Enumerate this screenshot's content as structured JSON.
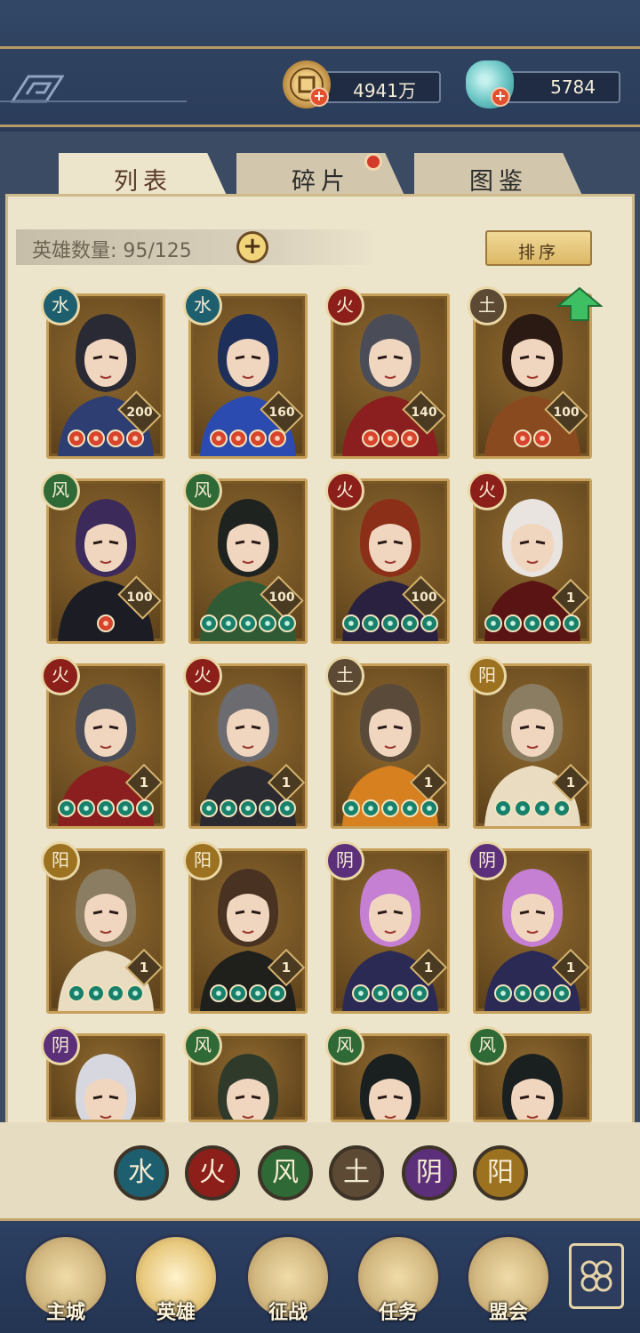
{
  "currency": {
    "coins": "4941万",
    "jade": "5784"
  },
  "tabs": [
    {
      "label": "列表",
      "active": true
    },
    {
      "label": "碎片",
      "active": false,
      "has_dot": true
    },
    {
      "label": "图鉴",
      "active": false
    }
  ],
  "hero_count": {
    "label": "英雄数量: 95/125",
    "add_icon": "plus-icon"
  },
  "sort_label": "排序",
  "heroes": [
    {
      "element": "水",
      "level": "200",
      "stars": 4,
      "star_color": "red",
      "hair": "#2a2a35",
      "cloth": "#2e3e72"
    },
    {
      "element": "水",
      "level": "160",
      "stars": 4,
      "star_color": "red",
      "hair": "#1e2f5a",
      "cloth": "#2c4bb0"
    },
    {
      "element": "火",
      "level": "140",
      "stars": 3,
      "star_color": "red",
      "hair": "#4a4d58",
      "cloth": "#8b1e1e"
    },
    {
      "element": "土",
      "level": "100",
      "stars": 2,
      "star_color": "red",
      "hair": "#2b1a14",
      "cloth": "#8a4a20",
      "upgrade": true
    },
    {
      "element": "风",
      "level": "100",
      "stars": 1,
      "star_color": "red",
      "hair": "#3c2a5a",
      "cloth": "#1c1c24"
    },
    {
      "element": "风",
      "level": "100",
      "stars": 5,
      "star_color": "green",
      "hair": "#1f231f",
      "cloth": "#2f5a34"
    },
    {
      "element": "火",
      "level": "100",
      "stars": 5,
      "star_color": "green",
      "hair": "#8b2f18",
      "cloth": "#2a2140"
    },
    {
      "element": "火",
      "level": "1",
      "stars": 5,
      "star_color": "green",
      "hair": "#e9e4e0",
      "cloth": "#5a1414"
    },
    {
      "element": "火",
      "level": "1",
      "stars": 5,
      "star_color": "green",
      "hair": "#4a4d58",
      "cloth": "#8b1e1e"
    },
    {
      "element": "火",
      "level": "1",
      "stars": 5,
      "star_color": "green",
      "hair": "#6b6b70",
      "cloth": "#2a2a30"
    },
    {
      "element": "土",
      "level": "1",
      "stars": 5,
      "star_color": "green",
      "hair": "#5a4a3a",
      "cloth": "#d68020"
    },
    {
      "element": "阳",
      "level": "1",
      "stars": 4,
      "star_color": "green",
      "hair": "#8b7d62",
      "cloth": "#e9dcc0"
    },
    {
      "element": "阳",
      "level": "1",
      "stars": 4,
      "star_color": "green",
      "hair": "#8b7d62",
      "cloth": "#e9dcc0"
    },
    {
      "element": "阳",
      "level": "1",
      "stars": 4,
      "star_color": "green",
      "hair": "#4a3222",
      "cloth": "#1f1f1c"
    },
    {
      "element": "阴",
      "level": "1",
      "stars": 4,
      "star_color": "green",
      "hair": "#c57fd3",
      "cloth": "#2a2a55"
    },
    {
      "element": "阴",
      "level": "1",
      "stars": 4,
      "star_color": "green",
      "hair": "#c57fd3",
      "cloth": "#2a2a55"
    },
    {
      "element": "阴",
      "level": "",
      "stars": 0,
      "star_color": "green",
      "hair": "#d7d7e0",
      "cloth": "#2a2440"
    },
    {
      "element": "风",
      "level": "",
      "stars": 0,
      "star_color": "green",
      "hair": "#2f3a2a",
      "cloth": "#3b4a2e"
    },
    {
      "element": "风",
      "level": "",
      "stars": 0,
      "star_color": "green",
      "hair": "#1a1f1f",
      "cloth": "#2e5a4a"
    },
    {
      "element": "风",
      "level": "",
      "stars": 0,
      "star_color": "green",
      "hair": "#1a1f1f",
      "cloth": "#2e5a4a"
    }
  ],
  "element_colors": {
    "水": "#1d5f6e",
    "火": "#8c1f1a",
    "风": "#2f6a36",
    "土": "#5c4a34",
    "阴": "#5b2f7a",
    "阳": "#9c7220"
  },
  "filters": [
    {
      "element": "水",
      "color": "#1d5f6e"
    },
    {
      "element": "火",
      "color": "#8c1f1a"
    },
    {
      "element": "风",
      "color": "#2f6a36"
    },
    {
      "element": "土",
      "color": "#5c4a34"
    },
    {
      "element": "阴",
      "color": "#5b2f7a"
    },
    {
      "element": "阳",
      "color": "#9c7220"
    }
  ],
  "nav": [
    {
      "label": "主城",
      "icon": "castle-icon"
    },
    {
      "label": "英雄",
      "icon": "hero-avatar-icon",
      "active": true
    },
    {
      "label": "征战",
      "icon": "battle-icon"
    },
    {
      "label": "任务",
      "icon": "quest-icon"
    },
    {
      "label": "盟会",
      "icon": "guild-icon"
    }
  ],
  "nav_more_icon": "menu-grid-icon"
}
